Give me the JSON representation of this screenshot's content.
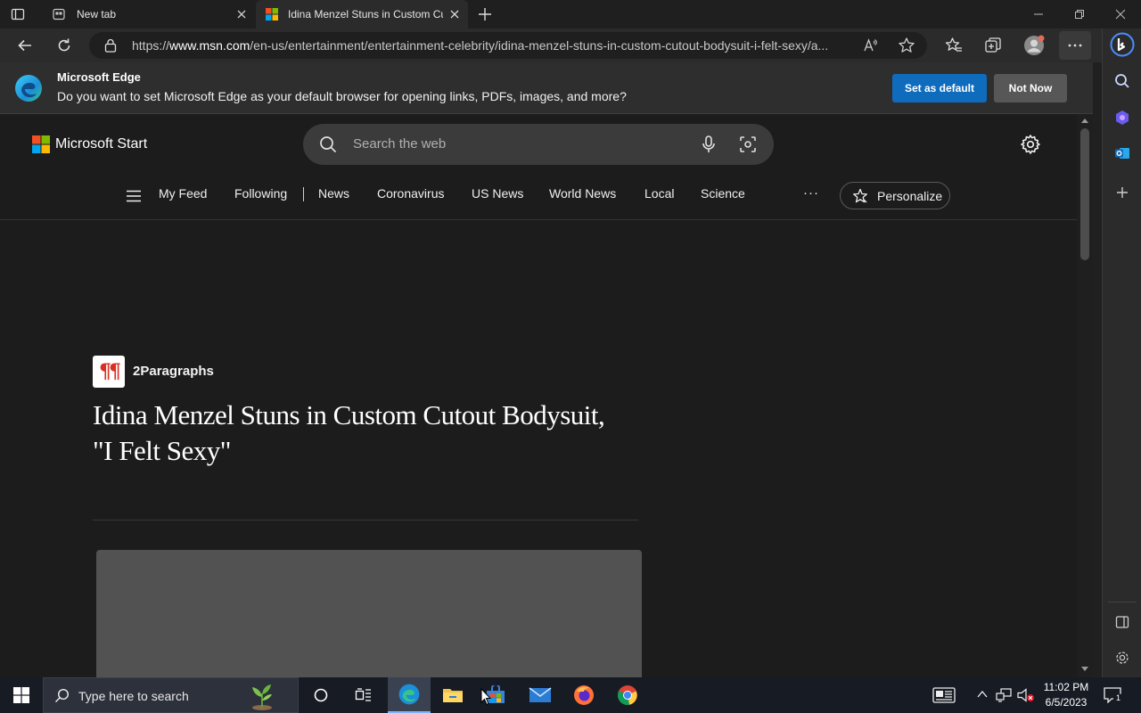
{
  "browser": {
    "tabs": [
      {
        "title": "New tab"
      },
      {
        "title": "Idina Menzel Stuns in Custom Cutout Bodysuit, \"I Felt Sexy\""
      }
    ],
    "url_prefix": "https://",
    "url_domain": "www.msn.com",
    "url_path": "/en-us/entertainment/entertainment-celebrity/idina-menzel-stuns-in-custom-cutout-bodysuit-i-felt-sexy/a..."
  },
  "banner": {
    "title": "Microsoft Edge",
    "message": "Do you want to set Microsoft Edge as your default browser for opening links, PDFs, images, and more?",
    "primary_label": "Set as default",
    "secondary_label": "Not Now"
  },
  "site": {
    "brand": "Microsoft Start",
    "search_placeholder": "Search the web",
    "nav": [
      "My Feed",
      "Following",
      "News",
      "Coronavirus",
      "US News",
      "World News",
      "Local",
      "Science"
    ],
    "more_label": "···",
    "personalize_label": "Personalize"
  },
  "article": {
    "source_name": "2Paragraphs",
    "source_logo_text": "¶¶",
    "headline_line1": "Idina Menzel Stuns in Custom Cutout Bodysuit,",
    "headline_line2": "\"I Felt Sexy\""
  },
  "taskbar": {
    "search_placeholder": "Type here to search",
    "time": "11:02 PM",
    "date": "6/5/2023",
    "notification_count": "1"
  },
  "colors": {
    "accent": "#0f6cbd",
    "page_bg": "#1c1c1c",
    "brand_red": "#d93025"
  }
}
